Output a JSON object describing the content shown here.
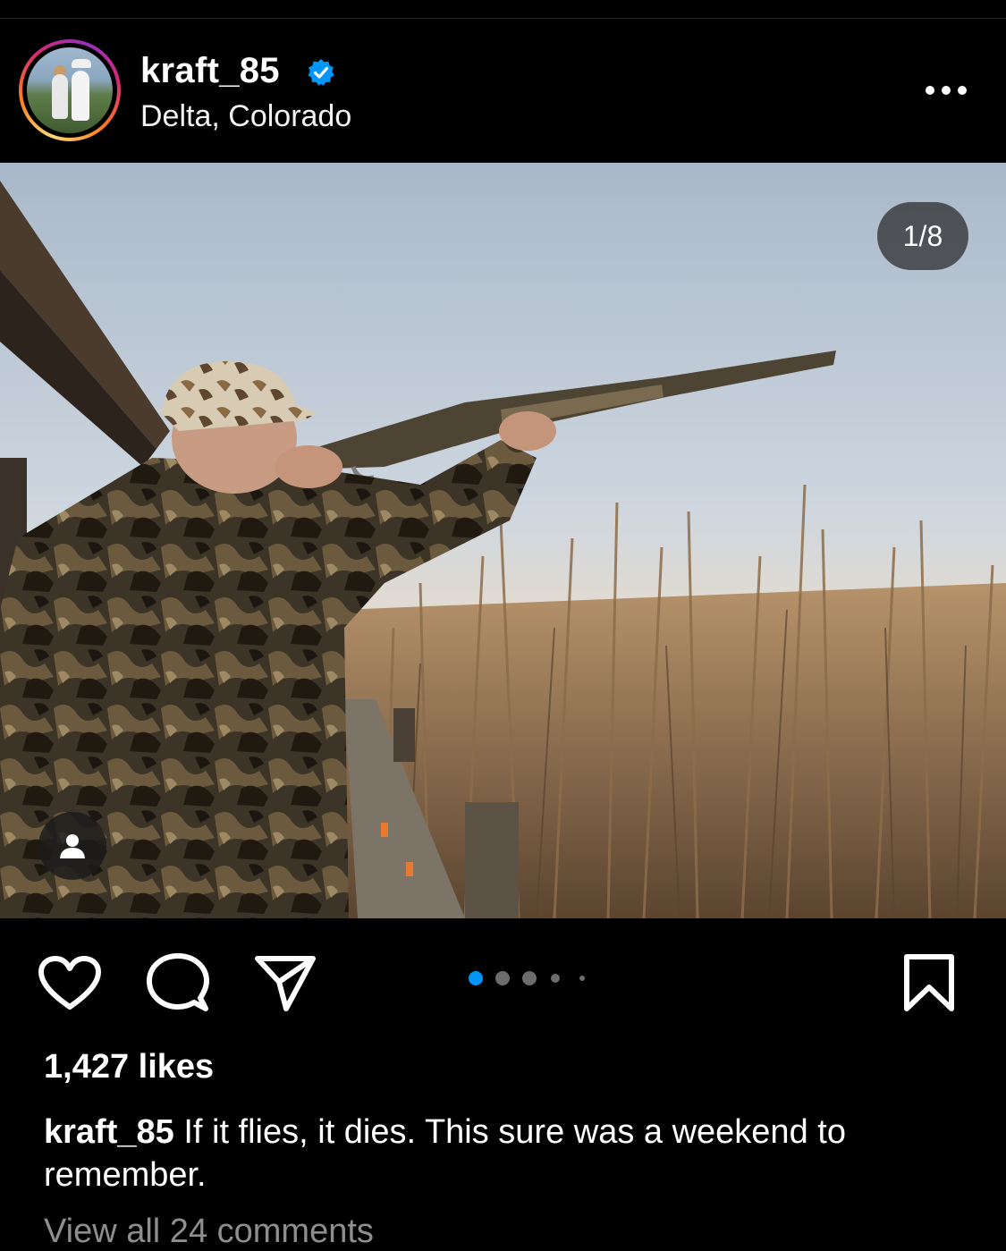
{
  "post": {
    "username": "kraft_85",
    "location": "Delta, Colorado",
    "verified": true,
    "image_counter": "1/8",
    "likes": "1,427 likes",
    "caption_username": "kraft_85",
    "caption_text": " If it flies, it dies. This sure was a weekend to remember.",
    "view_comments": "View all 24 comments"
  },
  "carousel": {
    "total_dots": 5,
    "active_index": 0
  },
  "icons": {
    "header": [
      "verified-badge-icon",
      "more-options-icon"
    ],
    "overlay": [
      "tagged-people-icon"
    ],
    "actions": [
      "heart-icon",
      "comment-icon",
      "share-icon",
      "bookmark-icon"
    ]
  },
  "colors": {
    "background": "#000000",
    "text": "#ffffff",
    "muted": "#8e8e8e",
    "verified": "#0095f6",
    "active_dot": "#0095f6"
  }
}
